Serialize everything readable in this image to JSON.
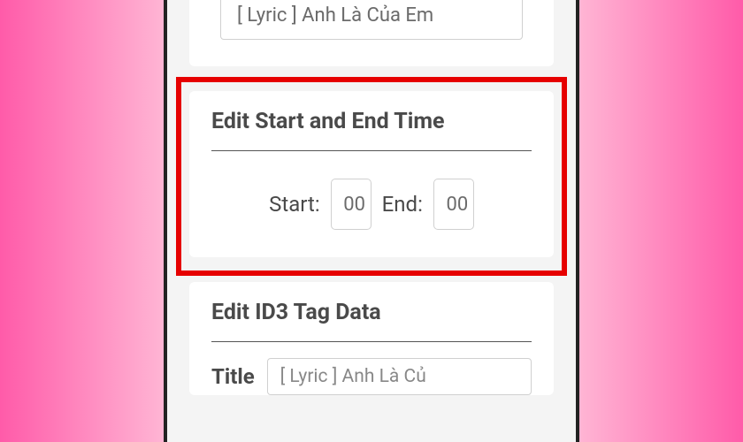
{
  "topCard": {
    "value": "[ Lyric ] Anh Là Của Em"
  },
  "timeCard": {
    "title": "Edit Start and End Time",
    "startLabel": "Start:",
    "startValue": "00",
    "endLabel": "End:",
    "endValue": "00"
  },
  "id3Card": {
    "title": "Edit ID3 Tag Data",
    "titleLabel": "Title",
    "titleValue": "[ Lyric ] Anh Là Củ"
  }
}
